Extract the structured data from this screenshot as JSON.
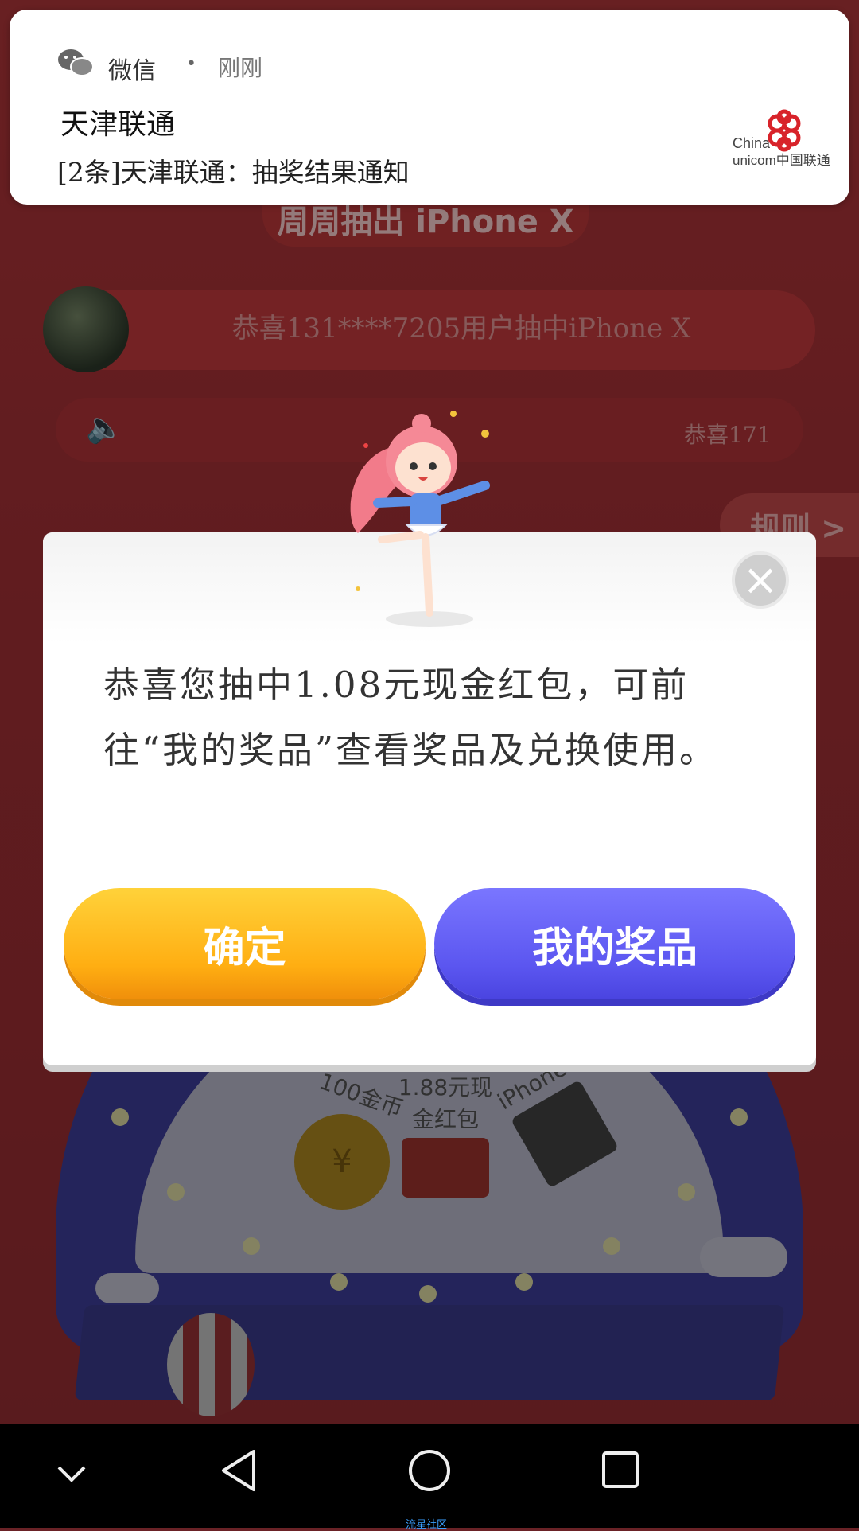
{
  "notification": {
    "app_name": "微信",
    "separator": "•",
    "time": "刚刚",
    "title": "天津联通",
    "body": "[2条]天津联通：抽奖结果通知",
    "logo_text_1": "China",
    "logo_text_2": "unicom中国联通"
  },
  "background": {
    "banner": "周周抽出 iPhone X",
    "winner_text": "恭喜131****7205用户抽中iPhone X",
    "announcement": "恭喜171",
    "rules_tab": "规则 >",
    "prize_labels": [
      "100金币",
      "1.88元现金红包",
      "iPhone X"
    ]
  },
  "modal": {
    "message": "恭喜您抽中1.08元现金红包，可前往“我的奖品”查看奖品及兑换使用。",
    "confirm_label": "确定",
    "my_prizes_label": "我的奖品"
  },
  "navbar": {
    "watermark": "流星社区"
  },
  "colors": {
    "confirm_button": "#ffb21a",
    "prizes_button": "#5e59f2",
    "page_background": "#a73136"
  }
}
